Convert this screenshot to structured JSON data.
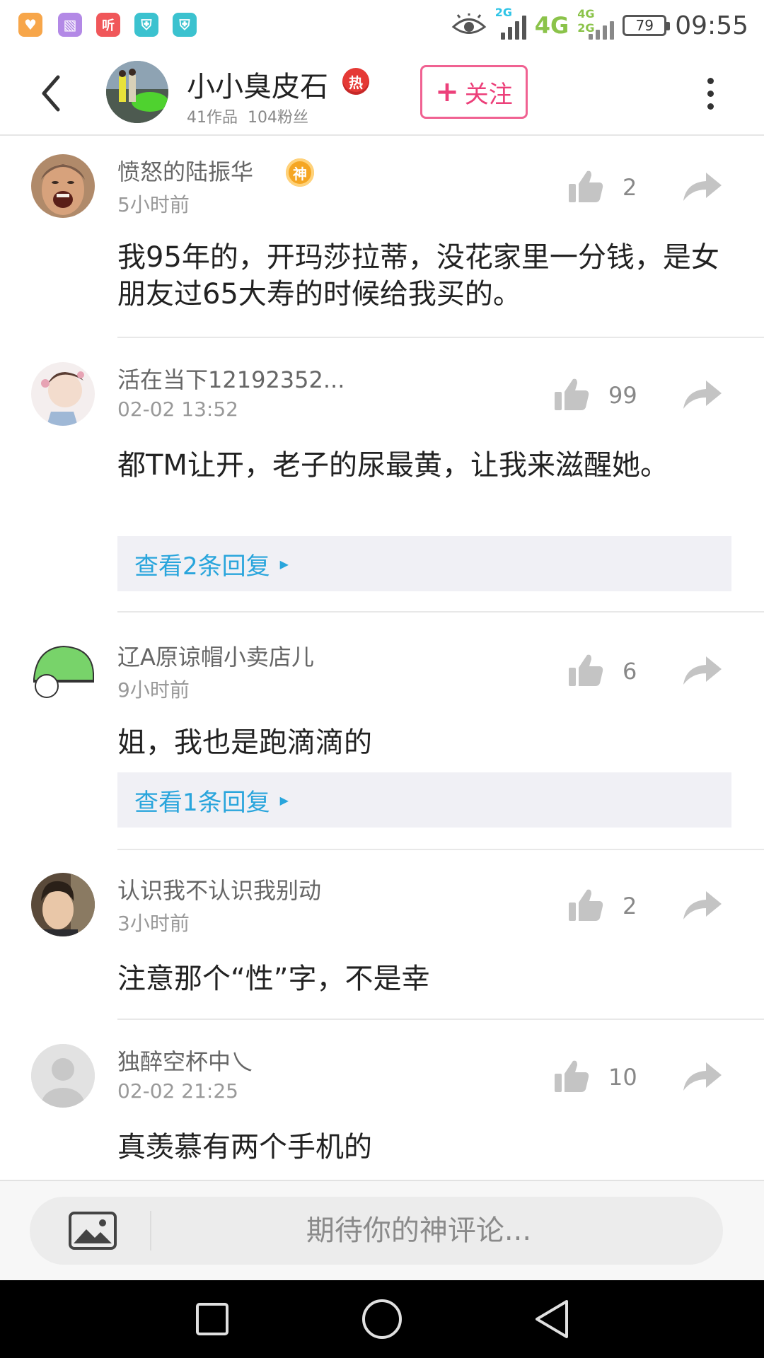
{
  "status_bar": {
    "app_icons": [
      {
        "name": "health-app-icon",
        "glyph": "♥",
        "color": "#f7a64a"
      },
      {
        "name": "gallery-app-icon",
        "glyph": "▧",
        "color": "#b389e6"
      },
      {
        "name": "listen-app-icon",
        "glyph": "听",
        "color": "#f0575a"
      },
      {
        "name": "shield-app-icon",
        "glyph": "⛨",
        "color": "#3bc2cf"
      },
      {
        "name": "shield-app-icon-2",
        "glyph": "⛨",
        "color": "#3bc2cf"
      }
    ],
    "net_primary": "4G",
    "net_small_top": "2G",
    "net_small_a": "4G",
    "net_small_b": "2G",
    "battery": "79",
    "time": "09:55"
  },
  "header": {
    "author_name": "小小臭皮石",
    "hot_badge": "热",
    "works": "41作品",
    "fans": "104粉丝",
    "follow_label": "关注",
    "accent_color": "#ec407a"
  },
  "comments": [
    {
      "name": "愤怒的陆振华",
      "badge": "神",
      "time": "5小时前",
      "likes": "2",
      "text": "我95年的，开玛莎拉蒂，没花家里一分钱，是女朋友过65大寿的时候给我买的。"
    },
    {
      "name": "活在当下12192352...",
      "time": "02-02 13:52",
      "likes": "99",
      "text": "都TM让开，老子的尿最黄，让我来滋醒她。",
      "reply_link": "查看2条回复"
    },
    {
      "name": "辽A原谅帽小卖店儿",
      "time": "9小时前",
      "likes": "6",
      "text": "姐，我也是跑滴滴的",
      "reply_link": "查看1条回复"
    },
    {
      "name": "认识我不认识我别动",
      "time": "3小时前",
      "likes": "2",
      "text": "注意那个“性”字，不是幸"
    },
    {
      "name": "独醉空杯中乀",
      "time": "02-02 21:25",
      "likes": "10",
      "text": "真羡慕有两个手机的"
    }
  ],
  "input": {
    "placeholder": "期待你的神评论..."
  },
  "colors": {
    "link": "#29a5dc",
    "follow": "#ec407a",
    "icon_gray": "#c4c4c4"
  }
}
